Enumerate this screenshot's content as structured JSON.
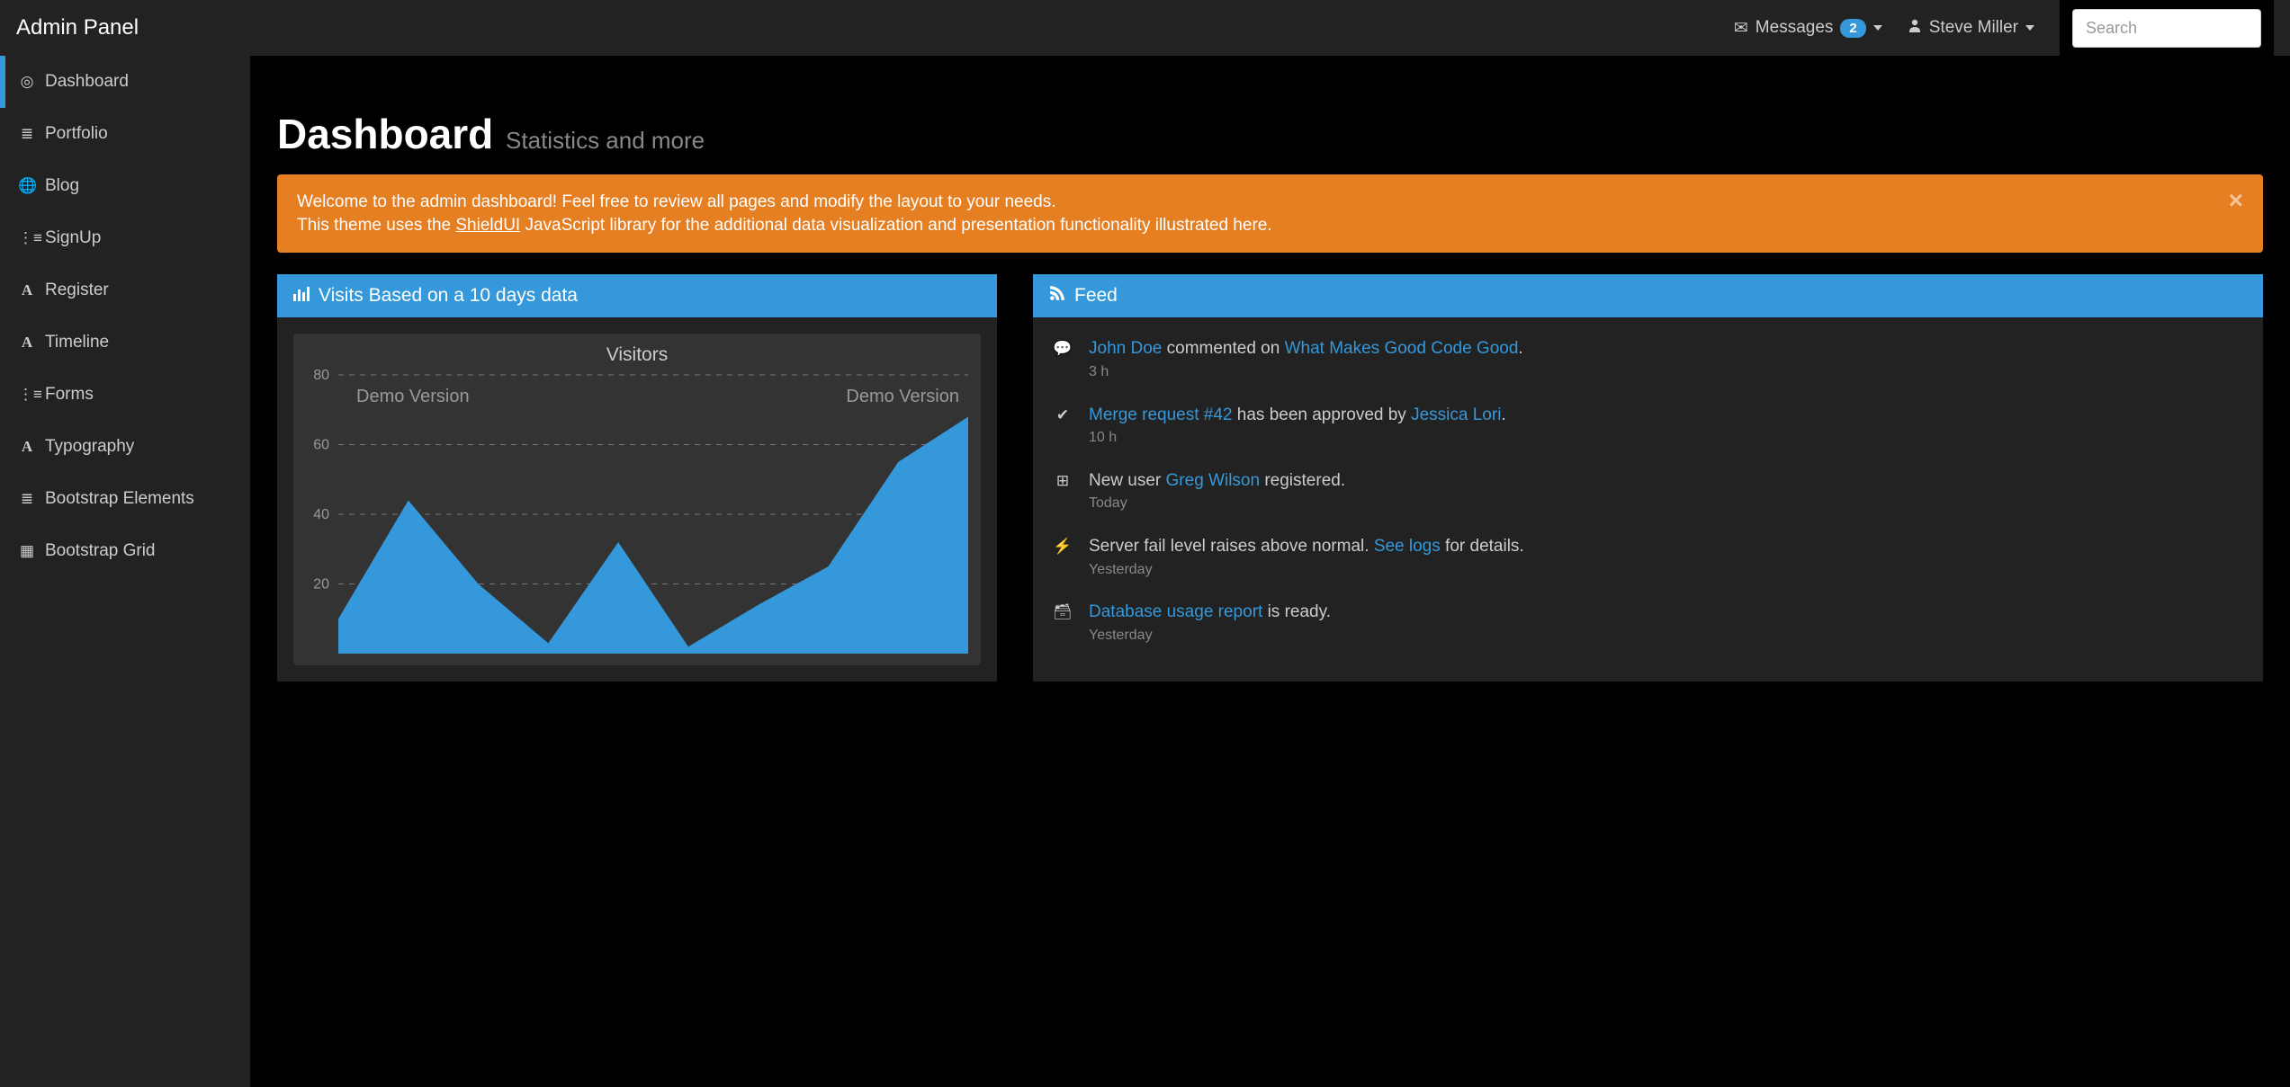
{
  "brand": "Admin Panel",
  "header": {
    "messages_label": "Messages",
    "messages_count": "2",
    "user_name": "Steve Miller",
    "search_placeholder": "Search"
  },
  "sidebar": {
    "items": [
      {
        "label": "Dashboard",
        "icon": "target-icon",
        "active": true
      },
      {
        "label": "Portfolio",
        "icon": "list-icon"
      },
      {
        "label": "Blog",
        "icon": "globe-icon"
      },
      {
        "label": "SignUp",
        "icon": "tasks-icon"
      },
      {
        "label": "Register",
        "icon": "font-icon"
      },
      {
        "label": "Timeline",
        "icon": "font-icon"
      },
      {
        "label": "Forms",
        "icon": "list-alt-icon"
      },
      {
        "label": "Typography",
        "icon": "font-icon"
      },
      {
        "label": "Bootstrap Elements",
        "icon": "list-ul-icon"
      },
      {
        "label": "Bootstrap Grid",
        "icon": "grid-icon"
      }
    ]
  },
  "page": {
    "title": "Dashboard",
    "subtitle": "Statistics and more"
  },
  "alert": {
    "line1": "Welcome to the admin dashboard! Feel free to review all pages and modify the layout to your needs.",
    "line2_pre": "This theme uses the ",
    "line2_link": "ShieldUI",
    "line2_post": " JavaScript library for the additional data visualization and presentation functionality illustrated here."
  },
  "visits_panel": {
    "title": "Visits Based on a 10 days data"
  },
  "feed_panel": {
    "title": "Feed",
    "items": [
      {
        "icon": "comment-icon",
        "text_parts": [
          {
            "t": "John Doe",
            "link": true
          },
          {
            "t": " commented on "
          },
          {
            "t": "What Makes Good Code Good",
            "link": true
          },
          {
            "t": "."
          }
        ],
        "time": "3 h"
      },
      {
        "icon": "check-icon",
        "text_parts": [
          {
            "t": "Merge request #42",
            "link": true
          },
          {
            "t": " has been approved by "
          },
          {
            "t": "Jessica Lori",
            "link": true
          },
          {
            "t": "."
          }
        ],
        "time": "10 h"
      },
      {
        "icon": "plus-square-icon",
        "text_parts": [
          {
            "t": "New user "
          },
          {
            "t": "Greg Wilson",
            "link": true
          },
          {
            "t": " registered."
          }
        ],
        "time": "Today"
      },
      {
        "icon": "bolt-icon",
        "text_parts": [
          {
            "t": "Server fail level raises above normal. "
          },
          {
            "t": "See logs",
            "link": true
          },
          {
            "t": " for details."
          }
        ],
        "time": "Yesterday"
      },
      {
        "icon": "archive-icon",
        "text_parts": [
          {
            "t": "Database usage report",
            "link": true
          },
          {
            "t": " is ready."
          }
        ],
        "time": "Yesterday"
      }
    ]
  },
  "chart_data": {
    "type": "area",
    "title": "Visitors",
    "ylabel": "",
    "xlabel": "",
    "ylim": [
      0,
      80
    ],
    "yticks": [
      20,
      40,
      60,
      80
    ],
    "watermark": "Demo Version",
    "x": [
      1,
      2,
      3,
      4,
      5,
      6,
      7,
      8,
      9,
      10
    ],
    "series": [
      {
        "name": "Visitors",
        "values": [
          10,
          44,
          20,
          3,
          32,
          2,
          14,
          25,
          55,
          68
        ]
      }
    ]
  }
}
